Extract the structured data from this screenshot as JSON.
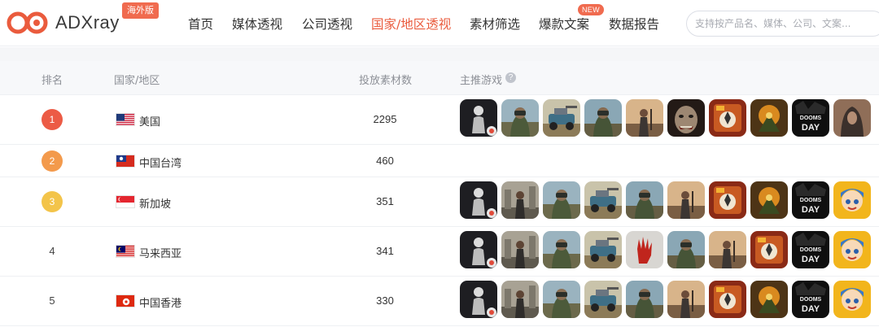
{
  "brand": {
    "name": "ADXray",
    "badge": "海外版",
    "accent": "#ea5b3d"
  },
  "nav": {
    "items": [
      {
        "label": "首页",
        "active": false
      },
      {
        "label": "媒体透视",
        "active": false
      },
      {
        "label": "公司透视",
        "active": false
      },
      {
        "label": "国家/地区透视",
        "active": true
      },
      {
        "label": "素材筛选",
        "active": false
      },
      {
        "label": "爆款文案",
        "active": false,
        "badge": "NEW"
      },
      {
        "label": "数据报告",
        "active": false
      }
    ],
    "search_placeholder": "支持按产品名、媒体、公司、文案..."
  },
  "table": {
    "headers": {
      "rank": "排名",
      "country": "国家/地区",
      "count": "投放素材数",
      "games": "主推游戏"
    },
    "help_icon": "question-circle-icon",
    "rows": [
      {
        "rank": "1",
        "country": "美国",
        "flag": "us-flag-icon",
        "count": "2295",
        "games": [
          "silhouette-figure-game-icon",
          "soldier-hood-game-icon",
          "armored-car-game-icon",
          "soldier-hood-game-icon",
          "wasteland-survivor-game-icon",
          "zombie-face-game-icon",
          "doomsday-soldier-game-icon",
          "wasteland-warrior-game-icon",
          "doomsday-text-game-icon",
          "hooded-survivor-game-icon"
        ]
      },
      {
        "rank": "2",
        "country": "中国台湾",
        "flag": "tw-flag-icon",
        "count": "460",
        "games": []
      },
      {
        "rank": "3",
        "country": "新加坡",
        "flag": "sg-flag-icon",
        "count": "351",
        "games": [
          "silhouette-figure-game-icon",
          "ruins-survivor-game-icon",
          "soldier-hood-game-icon",
          "armored-car-game-icon",
          "soldier-hood-game-icon",
          "wasteland-survivor-game-icon",
          "doomsday-soldier-game-icon",
          "wasteland-warrior-game-icon",
          "doomsday-text-game-icon",
          "cartoon-hero-game-icon"
        ]
      },
      {
        "rank": "4",
        "country": "马来西亚",
        "flag": "my-flag-icon",
        "count": "341",
        "games": [
          "silhouette-figure-game-icon",
          "ruins-survivor-game-icon",
          "soldier-hood-game-icon",
          "armored-car-game-icon",
          "red-hand-game-icon",
          "soldier-hood-game-icon",
          "wasteland-survivor-game-icon",
          "doomsday-soldier-game-icon",
          "doomsday-text-game-icon",
          "cartoon-hero-game-icon"
        ]
      },
      {
        "rank": "5",
        "country": "中国香港",
        "flag": "hk-flag-icon",
        "count": "330",
        "games": [
          "silhouette-figure-game-icon",
          "ruins-survivor-game-icon",
          "soldier-hood-game-icon",
          "armored-car-game-icon",
          "soldier-hood-game-icon",
          "wasteland-survivor-game-icon",
          "doomsday-soldier-game-icon",
          "wasteland-warrior-game-icon",
          "doomsday-text-game-icon",
          "cartoon-hero-game-icon"
        ]
      }
    ]
  },
  "colors": {
    "rank_1": "#ec5b45",
    "rank_2": "#f39a4c",
    "rank_3": "#f3c44a"
  },
  "game_text": {
    "doomsday": "DOOMS DAY"
  }
}
